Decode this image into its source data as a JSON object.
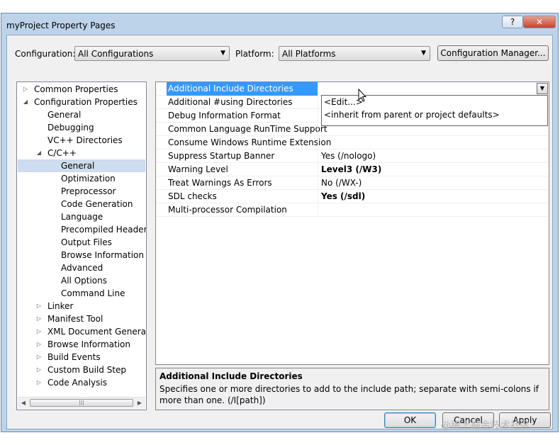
{
  "window": {
    "title": "myProject Property Pages",
    "help_label": "?",
    "close_label": "✕"
  },
  "config_bar": {
    "configuration_label": "Configuration:",
    "configuration_value": "All Configurations",
    "platform_label": "Platform:",
    "platform_value": "All Platforms",
    "config_manager_label": "Configuration Manager..."
  },
  "tree": {
    "items": [
      {
        "label": "Common Properties",
        "expander": "▷"
      },
      {
        "label": "Configuration Properties",
        "expander": "◢"
      },
      {
        "label": "General",
        "expander": ""
      },
      {
        "label": "Debugging",
        "expander": ""
      },
      {
        "label": "VC++ Directories",
        "expander": ""
      },
      {
        "label": "C/C++",
        "expander": "◢"
      },
      {
        "label": "General",
        "expander": "",
        "selected": true
      },
      {
        "label": "Optimization",
        "expander": ""
      },
      {
        "label": "Preprocessor",
        "expander": ""
      },
      {
        "label": "Code Generation",
        "expander": ""
      },
      {
        "label": "Language",
        "expander": ""
      },
      {
        "label": "Precompiled Headers",
        "expander": ""
      },
      {
        "label": "Output Files",
        "expander": ""
      },
      {
        "label": "Browse Information",
        "expander": ""
      },
      {
        "label": "Advanced",
        "expander": ""
      },
      {
        "label": "All Options",
        "expander": ""
      },
      {
        "label": "Command Line",
        "expander": ""
      },
      {
        "label": "Linker",
        "expander": "▷"
      },
      {
        "label": "Manifest Tool",
        "expander": "▷"
      },
      {
        "label": "XML Document Generator",
        "expander": "▷"
      },
      {
        "label": "Browse Information",
        "expander": "▷"
      },
      {
        "label": "Build Events",
        "expander": "▷"
      },
      {
        "label": "Custom Build Step",
        "expander": "▷"
      },
      {
        "label": "Code Analysis",
        "expander": "▷"
      }
    ],
    "scroll_left": "◀",
    "scroll_right": "▶",
    "scroll_grip": "|||"
  },
  "properties": {
    "rows": [
      {
        "name": "Additional Include Directories",
        "value": "",
        "bold": false,
        "selected": true
      },
      {
        "name": "Additional #using Directories",
        "value": "",
        "bold": false
      },
      {
        "name": "Debug Information Format",
        "value": "",
        "bold": false
      },
      {
        "name": "Common Language RunTime Support",
        "value": "",
        "bold": false
      },
      {
        "name": "Consume Windows Runtime Extension",
        "value": "",
        "bold": false
      },
      {
        "name": "Suppress Startup Banner",
        "value": "Yes (/nologo)",
        "bold": false
      },
      {
        "name": "Warning Level",
        "value": "Level3 (/W3)",
        "bold": true
      },
      {
        "name": "Treat Warnings As Errors",
        "value": "No (/WX-)",
        "bold": false
      },
      {
        "name": "SDL checks",
        "value": "Yes (/sdl)",
        "bold": true
      },
      {
        "name": "Multi-processor Compilation",
        "value": "",
        "bold": false
      }
    ],
    "dropdown_arrow": "▼",
    "dropdown_items": [
      "<Edit...>",
      "<inherit from parent or project defaults>"
    ]
  },
  "description": {
    "title": "Additional Include Directories",
    "text": "Specifies one or more directories to add to the include path; separate with semi-colons if more than one.     (/I[path])"
  },
  "buttons": {
    "ok": "OK",
    "cancel": "Cancel",
    "apply": "Apply"
  },
  "watermark": "@稀土掘金技术社区"
}
